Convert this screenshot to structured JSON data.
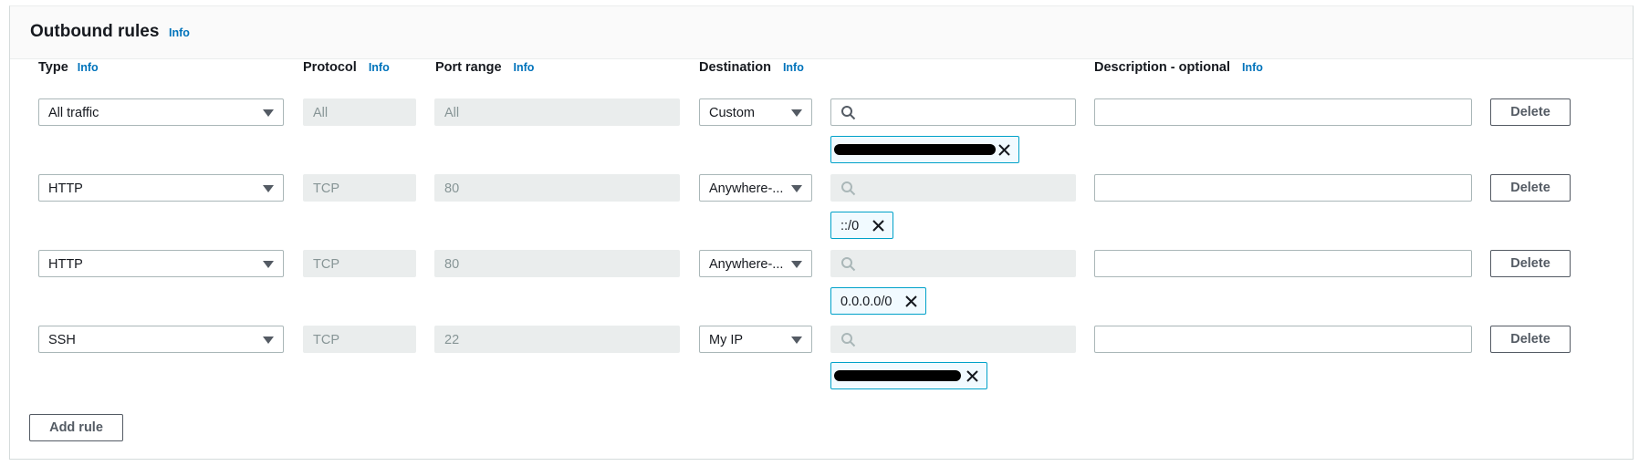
{
  "panel": {
    "title": "Outbound rules",
    "title_info": "Info"
  },
  "columns": {
    "type": "Type",
    "type_info": "Info",
    "protocol": "Protocol",
    "protocol_info": "Info",
    "port_range": "Port range",
    "port_range_info": "Info",
    "destination": "Destination",
    "destination_info": "Info",
    "description": "Description - optional",
    "description_info": "Info"
  },
  "rules": [
    {
      "type": "All traffic",
      "protocol": "All",
      "port_range": "All",
      "destination": "Custom",
      "token": "",
      "delete": "Delete"
    },
    {
      "type": "HTTP",
      "protocol": "TCP",
      "port_range": "80",
      "destination": "Anywhere-...",
      "token": "::/0",
      "delete": "Delete"
    },
    {
      "type": "HTTP",
      "protocol": "TCP",
      "port_range": "80",
      "destination": "Anywhere-...",
      "token": "0.0.0.0/0",
      "delete": "Delete"
    },
    {
      "type": "SSH",
      "protocol": "TCP",
      "port_range": "22",
      "destination": "My IP",
      "token": "",
      "delete": "Delete"
    }
  ],
  "add_rule": "Add rule",
  "colors": {
    "link": "#0073bb",
    "token_border": "#00a1c9",
    "disabled_bg": "#eaeded"
  },
  "icons": {
    "search": "search-icon",
    "caret": "caret-down-icon",
    "remove": "close-icon"
  }
}
